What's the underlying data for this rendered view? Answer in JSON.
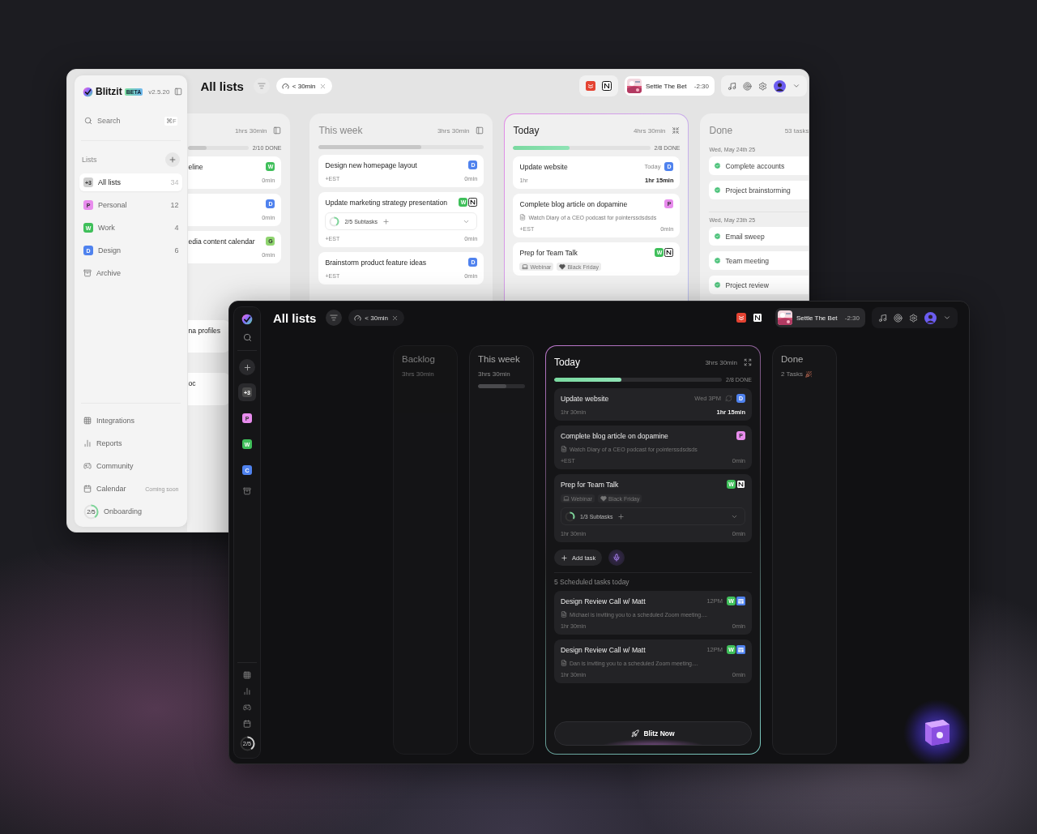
{
  "light_window": {
    "sidebar": {
      "brand": "Blitzit",
      "brand_badge": "BETA",
      "version": "v2.5.20",
      "search": {
        "placeholder": "Search",
        "shortcut": "⌘F"
      },
      "lists_heading": "Lists",
      "lists": [
        {
          "kind": "list",
          "badge": "+3",
          "label": "All lists",
          "count": "34",
          "color": "#cfcfcf",
          "selected": true
        },
        {
          "kind": "list",
          "badge": "P",
          "label": "Personal",
          "count": "12",
          "color": "#e88ced",
          "selected": false
        },
        {
          "kind": "list",
          "badge": "W",
          "label": "Work",
          "count": "4",
          "color": "#3fbf5a",
          "selected": false
        },
        {
          "kind": "list",
          "badge": "D",
          "label": "Design",
          "count": "6",
          "color": "#4f82ee",
          "selected": false
        },
        {
          "kind": "archive",
          "label": "Archive",
          "selected": false
        }
      ],
      "footer": [
        {
          "kind": "integrations",
          "label": "Integrations"
        },
        {
          "kind": "reports",
          "label": "Reports"
        },
        {
          "kind": "community",
          "label": "Community"
        },
        {
          "kind": "calendar",
          "label": "Calendar",
          "note": "Coming soon"
        },
        {
          "kind": "onboarding",
          "label": "Onboarding",
          "progress": "2/5",
          "level": 0.4
        }
      ]
    },
    "header": {
      "title": "All lists",
      "filter": "< 30min",
      "player": {
        "track": "Settle The Bet",
        "time": "-2:30"
      }
    },
    "columns": [
      {
        "kind": "cut",
        "time": "1hrs 30min",
        "done": "2/10 DONE",
        "level": 0.3,
        "cards": [
          {
            "title": "eline",
            "tags": [
              {
                "kind": "letter",
                "letter": "W",
                "color": "#3fbf5a"
              }
            ],
            "right": "0min",
            "strong": false
          },
          {
            "tags": [
              {
                "kind": "letter",
                "letter": "D",
                "color": "#4f82ee"
              }
            ],
            "right": "0min",
            "strong": false
          },
          {
            "title": "edia content calendar",
            "tags": [
              {
                "kind": "letter",
                "letter": "G",
                "color": "#8fd46f"
              }
            ],
            "right": "0min",
            "strong": false
          }
        ],
        "later_cards": [
          {
            "title": "na profiles"
          },
          {
            "title": "oc"
          }
        ]
      },
      {
        "kind": "list",
        "title": "This week",
        "time": "3hrs 30min",
        "level": 0.62,
        "cards": [
          {
            "title": "Design new homepage layout",
            "tags": [
              {
                "kind": "letter",
                "letter": "D",
                "color": "#4f82ee"
              }
            ],
            "left": "+EST",
            "right": "0min",
            "strong": false
          },
          {
            "title": "Update marketing strategy presentation",
            "tags": [
              {
                "kind": "letter",
                "letter": "W",
                "color": "#3fbf5a"
              },
              {
                "kind": "app"
              }
            ],
            "subtasks": {
              "text": "2/5 Subtasks",
              "level": 0.4
            },
            "left": "+EST",
            "right": "0min",
            "strong": false
          },
          {
            "title": "Brainstorm product feature ideas",
            "tags": [
              {
                "kind": "letter",
                "letter": "D",
                "color": "#4f82ee"
              }
            ],
            "left": "+EST",
            "right": "0min",
            "strong": false
          }
        ]
      },
      {
        "kind": "list",
        "title": "Today",
        "time": "4hrs 30min",
        "done": "2/8 DONE",
        "level": 0.41,
        "cards": [
          {
            "title": "Update website",
            "meta": "Today",
            "tags": [
              {
                "kind": "letter",
                "letter": "D",
                "color": "#4f82ee"
              }
            ],
            "left": "1hr",
            "right": "1hr 15min",
            "strong": true
          },
          {
            "title": "Complete blog article on dopamine",
            "tags": [
              {
                "kind": "letter",
                "letter": "P",
                "color": "#e88ced"
              }
            ],
            "note": "Watch Diary of a CEO podcast for pointerssdsdsds",
            "left": "+EST",
            "right": "0min",
            "strong": false
          },
          {
            "title": "Prep for Team Talk",
            "tags": [
              {
                "kind": "letter",
                "letter": "W",
                "color": "#3fbf5a"
              },
              {
                "kind": "app"
              }
            ],
            "labels": [
              {
                "kind": "laptop",
                "text": "Webinar"
              },
              {
                "kind": "heart",
                "text": "Black Friday"
              }
            ]
          }
        ]
      },
      {
        "kind": "done",
        "title": "Done",
        "count": "53 tasks",
        "groups": [
          {
            "date": "Wed, May 24th 25",
            "items": [
              "Complete accounts",
              "Project brainstorming"
            ]
          },
          {
            "date": "Wed, May 23th 25",
            "items": [
              "Email sweep",
              "Team meeting",
              "Project review"
            ]
          }
        ]
      }
    ]
  },
  "dark_window": {
    "rail": {
      "badges": [
        {
          "badge": "+3",
          "color": "#4a4a4a",
          "selected": true
        },
        {
          "badge": "P",
          "color": "#e88ced",
          "selected": false
        },
        {
          "badge": "W",
          "color": "#3fbf5a",
          "selected": false
        },
        {
          "badge": "C",
          "color": "#4f82ee",
          "selected": false
        }
      ],
      "onboarding": {
        "progress": "2/5",
        "level": 0.4
      }
    },
    "header": {
      "title": "All lists",
      "filter": "< 30min",
      "player": {
        "track": "Settle The Bet",
        "time": "-2:30"
      }
    },
    "columns": [
      {
        "kind": "collapsed",
        "title": "Backlog",
        "time": "3hrs 30min",
        "faded": true,
        "celebrate": false
      },
      {
        "kind": "collapsed",
        "title": "This week",
        "time": "3hrs 30min",
        "level": 0.6,
        "faded": false,
        "celebrate": false
      },
      {
        "kind": "list",
        "title": "Today",
        "time": "3hrs 30min",
        "done": "2/8 DONE",
        "level": 0.4,
        "cards": [
          {
            "title": "Update website",
            "meta": "Wed 3PM",
            "repeat": true,
            "tags": [
              {
                "kind": "letter",
                "letter": "D",
                "color": "#4f82ee"
              }
            ],
            "left": "1hr 30min",
            "right": "1hr 15min",
            "strong": true
          },
          {
            "title": "Complete blog article on dopamine",
            "repeat": false,
            "tags": [
              {
                "kind": "letter",
                "letter": "P",
                "color": "#e88ced"
              }
            ],
            "note": "Watch Diary of a CEO podcast for pointerssdsdsds",
            "left": "+EST",
            "right": "0min",
            "strong": false
          },
          {
            "title": "Prep for Team Talk",
            "repeat": false,
            "tags": [
              {
                "kind": "letter",
                "letter": "W",
                "color": "#3fbf5a"
              },
              {
                "kind": "app"
              }
            ],
            "labels": [
              {
                "kind": "laptop",
                "text": "Webinar"
              },
              {
                "kind": "heart",
                "text": "Black Friday"
              }
            ],
            "subtasks": {
              "text": "1/3 Subtasks",
              "level": 0.33
            },
            "left": "1hr 30min",
            "right": "0min",
            "strong": false
          }
        ],
        "add_task": "Add task",
        "scheduled_heading": "5 Scheduled tasks today",
        "scheduled": [
          {
            "title": "Design Review Call w/ Matt",
            "meta": "12PM",
            "tags": [
              {
                "kind": "letter",
                "letter": "W",
                "color": "#3fbf5a"
              },
              {
                "kind": "calendar"
              }
            ],
            "note": "Michael is inviting you to a scheduled Zoom meeting....",
            "left": "1hr 30min",
            "right": "0min",
            "strong": false
          },
          {
            "title": "Design Review Call w/ Matt",
            "meta": "12PM",
            "tags": [
              {
                "kind": "letter",
                "letter": "W",
                "color": "#3fbf5a"
              },
              {
                "kind": "calendar"
              }
            ],
            "note": "Dan is inviting you to a scheduled Zoom meeting....",
            "left": "1hr 30min",
            "right": "0min",
            "strong": false
          }
        ],
        "action": "Blitz Now"
      },
      {
        "kind": "collapsed",
        "title": "Done",
        "time": "2 Tasks",
        "faded": false,
        "celebrate": true
      }
    ]
  }
}
